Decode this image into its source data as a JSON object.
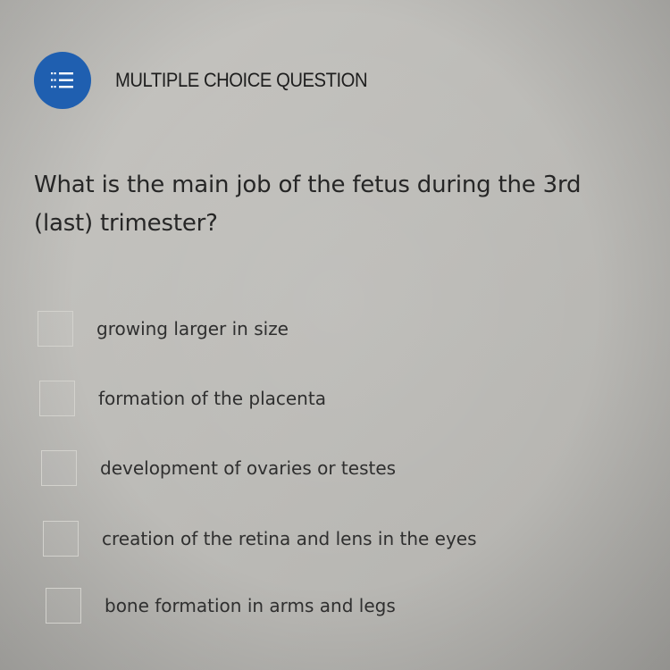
{
  "question_type": {
    "label": "MULTIPLE CHOICE QUESTION",
    "icon": "list-check-icon",
    "color": "#1f5fb0"
  },
  "question": {
    "text": "What is the main job of the fetus during the 3rd (last) trimester?"
  },
  "choices": [
    {
      "label": "growing larger in size",
      "checked": false
    },
    {
      "label": "formation of the placenta",
      "checked": false
    },
    {
      "label": "development of ovaries or testes",
      "checked": false
    },
    {
      "label": "creation of the retina and lens in the eyes",
      "checked": false
    },
    {
      "label": "bone formation in arms and legs",
      "checked": false
    }
  ]
}
